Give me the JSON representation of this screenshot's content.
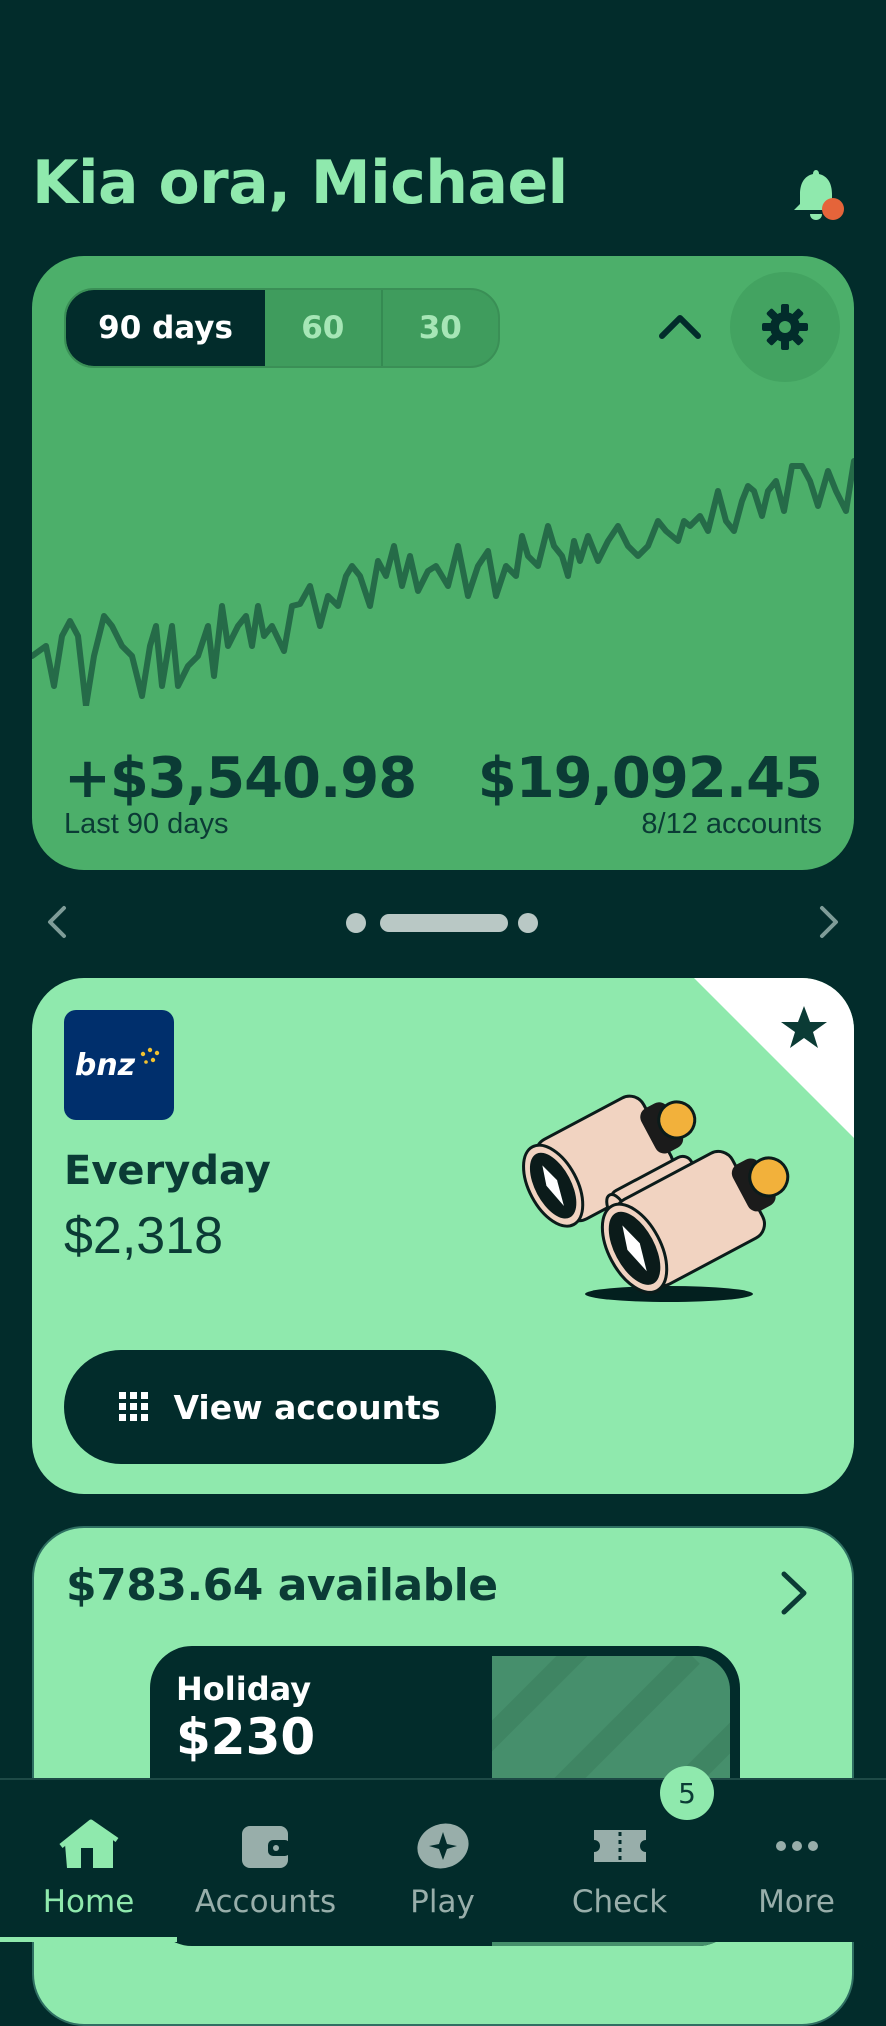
{
  "greeting": "Kia ora, Michael",
  "summary": {
    "periods": [
      "90 days",
      "60",
      "30"
    ],
    "selected_period": "90 days",
    "change": "+$3,540.98",
    "change_label": "Last 90 days",
    "total": "$19,092.45",
    "accounts_label": "8/12 accounts"
  },
  "carousel": {
    "pages": 3,
    "active_page": 2
  },
  "account_card": {
    "bank_logo": "bnz",
    "name": "Everyday",
    "balance": "$2,318",
    "button_label": "View accounts",
    "favourite": true
  },
  "available_card": {
    "title": "$783.64 available",
    "pot_name": "Holiday",
    "pot_amount": "$230"
  },
  "bottom_nav": {
    "items": [
      {
        "label": "Home",
        "icon": "home-icon"
      },
      {
        "label": "Accounts",
        "icon": "wallet-icon"
      },
      {
        "label": "Play",
        "icon": "play-icon"
      },
      {
        "label": "Check",
        "icon": "ticket-icon"
      },
      {
        "label": "More",
        "icon": "more-icon"
      }
    ],
    "active": "Home",
    "check_badge": "5"
  },
  "colors": {
    "background": "#022c2b",
    "accent": "#8fe9ad",
    "card_green": "#4caf6a",
    "notification_dot": "#e5643a"
  }
}
